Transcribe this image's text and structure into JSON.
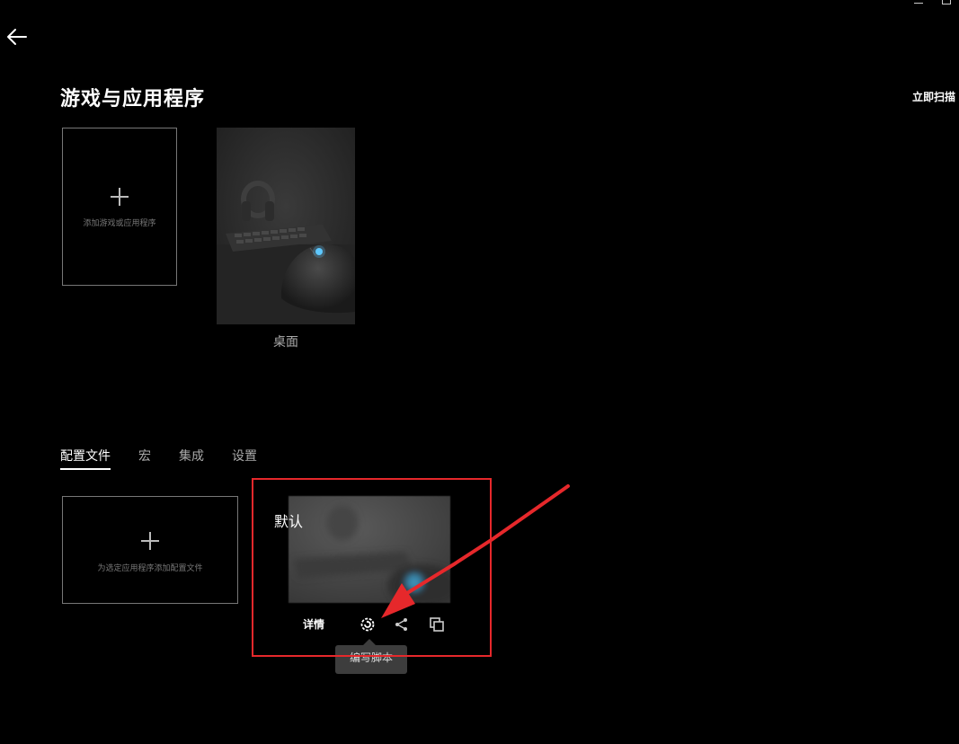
{
  "page": {
    "title": "游戏与应用程序",
    "scan_now": "立即扫描"
  },
  "games": {
    "add_label": "添加游戏或应用程序",
    "items": [
      {
        "label": "桌面"
      }
    ]
  },
  "tabs": [
    {
      "label": "配置文件",
      "active": true
    },
    {
      "label": "宏",
      "active": false
    },
    {
      "label": "集成",
      "active": false
    },
    {
      "label": "设置",
      "active": false
    }
  ],
  "profiles": {
    "add_label": "为选定应用程序添加配置文件",
    "items": [
      {
        "name": "默认",
        "details_label": "详情",
        "tooltip": "编写脚本"
      }
    ]
  },
  "annotation": {
    "color": "#e6282b"
  }
}
